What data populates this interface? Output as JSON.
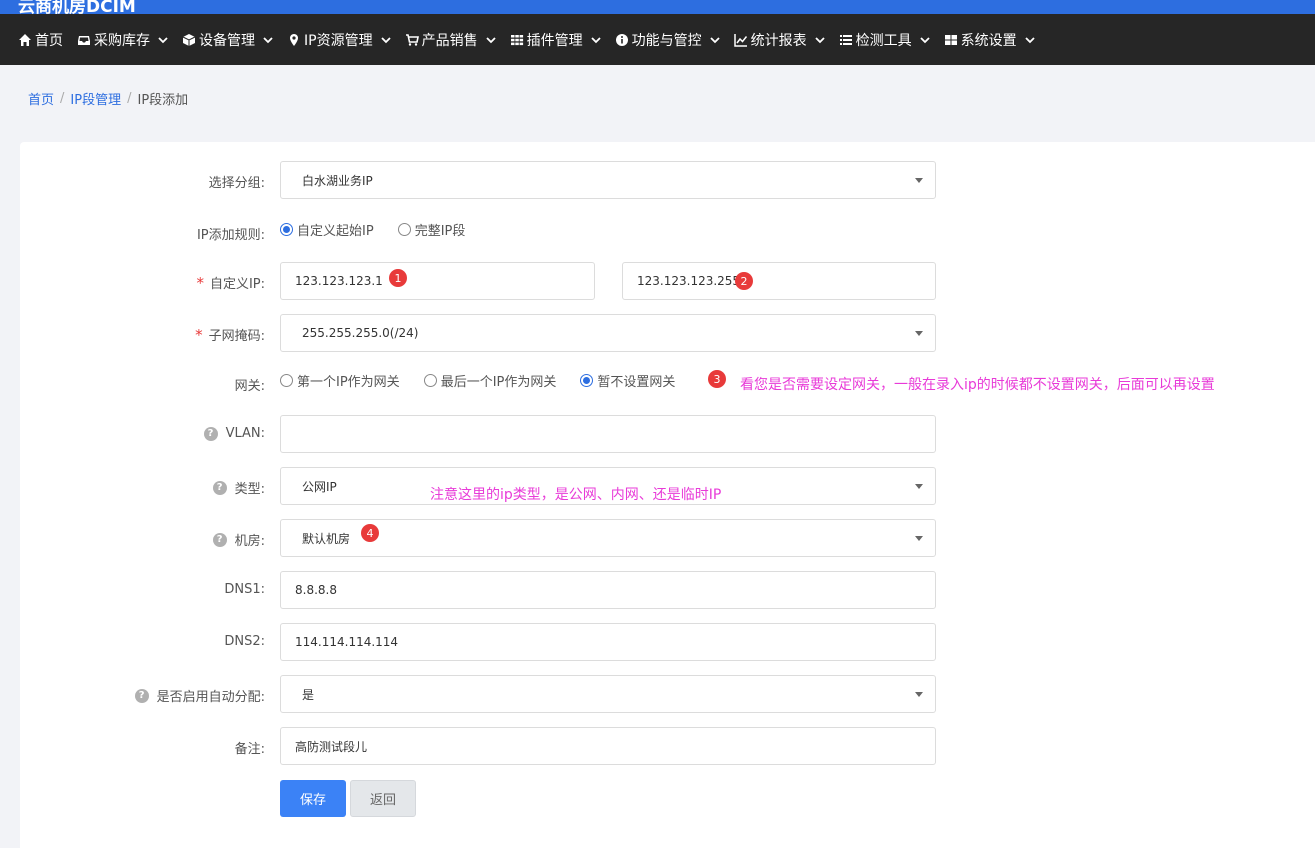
{
  "brand": "云商机房DCIM",
  "nav": [
    {
      "label": "首页",
      "icon": "home-icon",
      "dropdown": false
    },
    {
      "label": "采购库存",
      "icon": "inbox-icon",
      "dropdown": true
    },
    {
      "label": "设备管理",
      "icon": "cube-icon",
      "dropdown": true
    },
    {
      "label": "IP资源管理",
      "icon": "map-marker-icon",
      "dropdown": true
    },
    {
      "label": "产品销售",
      "icon": "cart-icon",
      "dropdown": true
    },
    {
      "label": "插件管理",
      "icon": "grid-icon",
      "dropdown": true
    },
    {
      "label": "功能与管控",
      "icon": "info-icon",
      "dropdown": true
    },
    {
      "label": "统计报表",
      "icon": "line-chart-icon",
      "dropdown": true
    },
    {
      "label": "检测工具",
      "icon": "list-icon",
      "dropdown": true
    },
    {
      "label": "系统设置",
      "icon": "windows-icon",
      "dropdown": true
    }
  ],
  "breadcrumb": [
    "首页",
    "IP段管理",
    "IP段添加"
  ],
  "form": {
    "group": {
      "label": "选择分组:",
      "value": "白水湖业务IP"
    },
    "rule": {
      "label": "IP添加规则:",
      "options": [
        "自定义起始IP",
        "完整IP段"
      ],
      "selected": 0
    },
    "custom_ip": {
      "label": "自定义IP:",
      "start": "123.123.123.1",
      "end": "123.123.123.255"
    },
    "mask": {
      "label": "子网掩码:",
      "value": "255.255.255.0(/24)"
    },
    "gateway": {
      "label": "网关:",
      "options": [
        "第一个IP作为网关",
        "最后一个IP作为网关",
        "暂不设置网关"
      ],
      "selected": 2
    },
    "vlan": {
      "label": "VLAN:",
      "value": ""
    },
    "type": {
      "label": "类型:",
      "value": "公网IP"
    },
    "room": {
      "label": "机房:",
      "value": "默认机房"
    },
    "dns1": {
      "label": "DNS1:",
      "value": "8.8.8.8"
    },
    "dns2": {
      "label": "DNS2:",
      "value": "114.114.114.114"
    },
    "auto": {
      "label": "是否启用自动分配:",
      "value": "是"
    },
    "remark": {
      "label": "备注:",
      "value": "高防测试段儿"
    }
  },
  "buttons": {
    "save": "保存",
    "back": "返回"
  },
  "annotations": {
    "badges": [
      "1",
      "2",
      "3",
      "4"
    ],
    "gateway_note": "看您是否需要设定网关，一般在录入ip的时候都不设置网关，后面可以再设置",
    "type_note": "注意这里的ip类型，是公网、内网、还是临时IP"
  },
  "colors": {
    "navbar": "#262626",
    "accent": "#2d6ee0",
    "primary_button": "#3b82f6",
    "badge": "#e83a3a",
    "note": "#e83ad8"
  }
}
